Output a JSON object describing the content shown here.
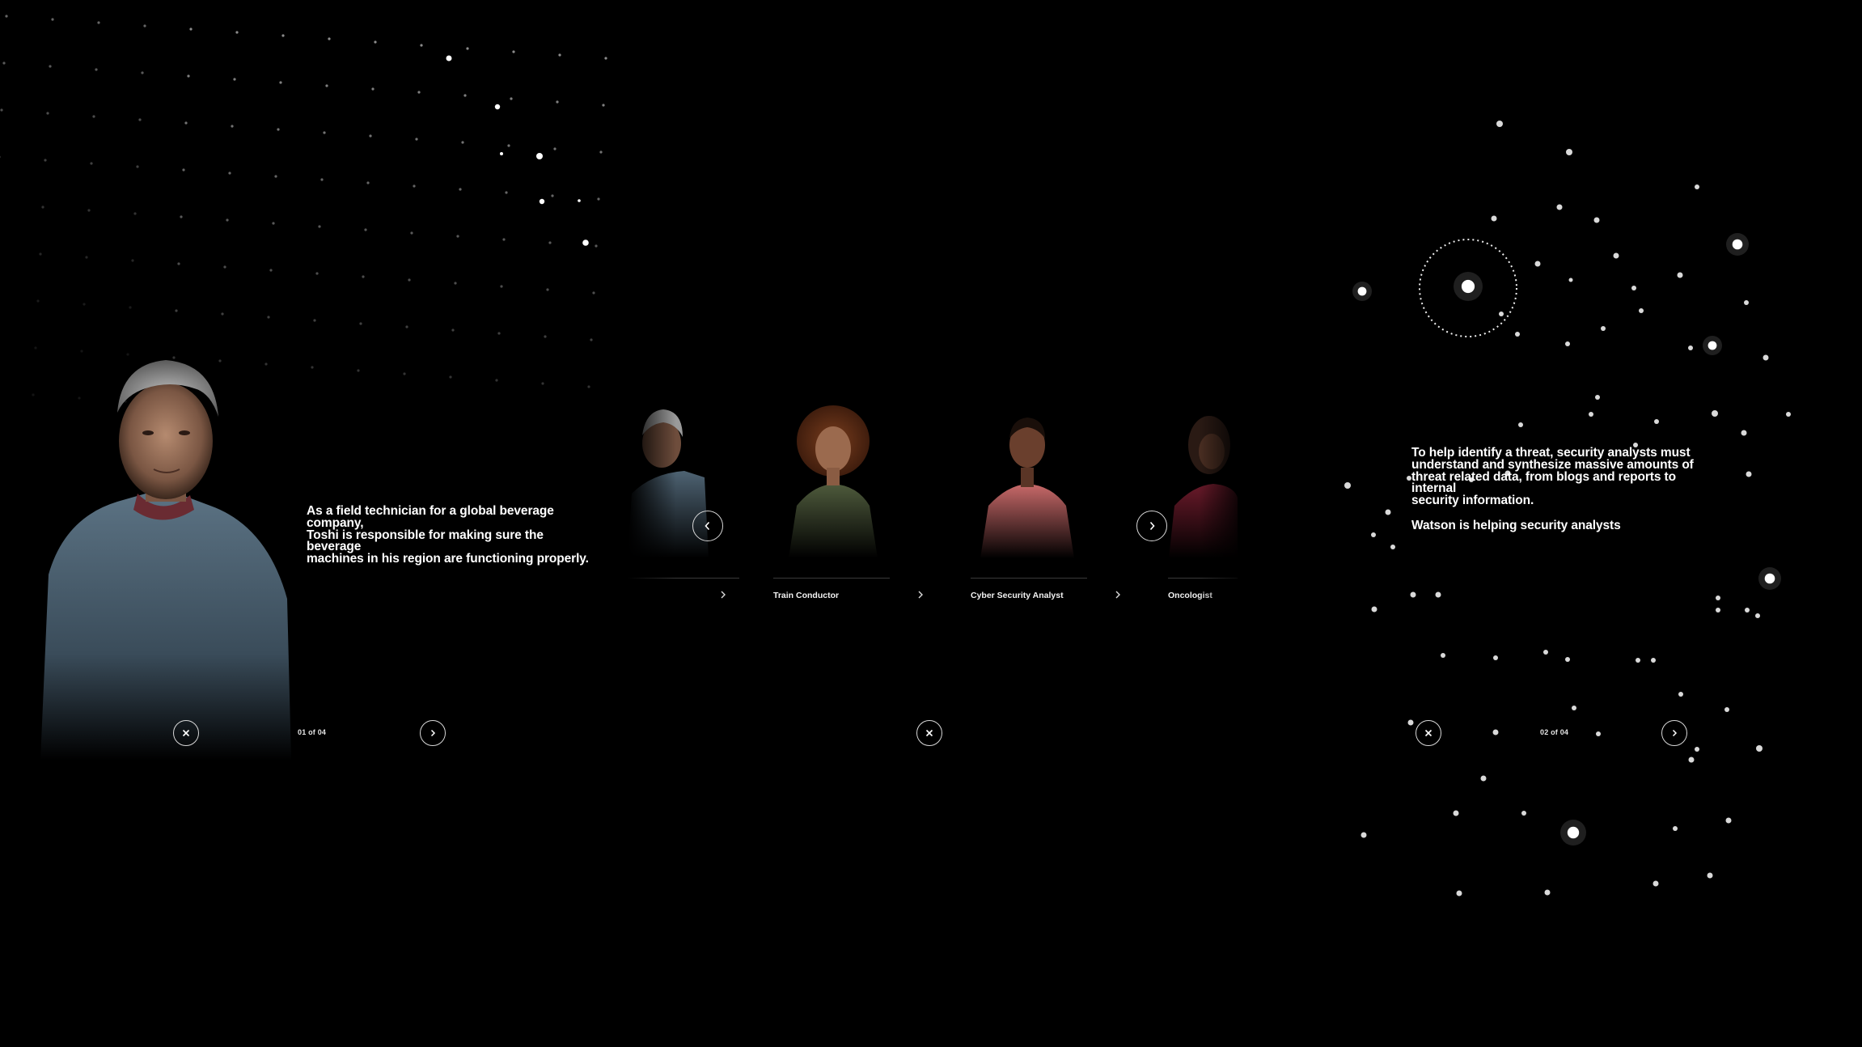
{
  "left": {
    "description": "As a field technician for a global beverage company, Toshi is responsible for making sure the beverage machines in his region are functioning properly.",
    "description_lines": [
      "As a field technician for a global beverage company,",
      "Toshi is responsible for making sure the beverage",
      "machines in his region are functioning properly."
    ],
    "counter": "01 of 04",
    "close_icon": "close-icon",
    "next_icon": "chevron-right-icon"
  },
  "middle": {
    "cards": [
      {
        "label": "",
        "partial": true
      },
      {
        "label": "Train Conductor"
      },
      {
        "label": "Cyber Security Analyst"
      },
      {
        "label": "Oncologist",
        "partial": true
      }
    ],
    "prev_icon": "chevron-left-icon",
    "next_icon": "chevron-right-icon",
    "close_icon": "close-icon"
  },
  "right": {
    "description_lines": [
      "To help identify a threat, security analysts must",
      "understand and synthesize massive amounts of",
      "threat related data, from blogs and reports to internal",
      "security information."
    ],
    "description_tail": "Watson is helping security analysts",
    "counter": "02 of 04",
    "close_icon": "close-icon",
    "next_icon": "chevron-right-icon"
  },
  "colors": {
    "background": "#000000",
    "text": "#ffffff",
    "button_border": "#d8d8d8"
  }
}
